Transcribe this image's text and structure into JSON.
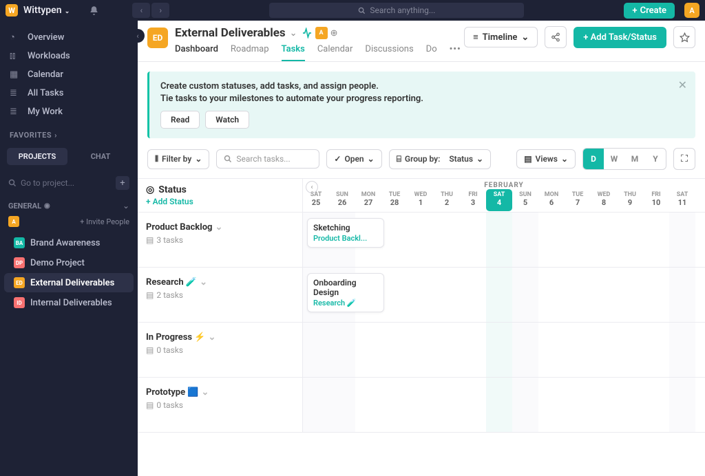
{
  "topbar": {
    "workspace": "Wittypen",
    "search_placeholder": "Search anything...",
    "create_label": "Create",
    "avatar_initial": "A"
  },
  "sidebar": {
    "nav": [
      {
        "label": "Overview",
        "icon": "dashboard-icon"
      },
      {
        "label": "Workloads",
        "icon": "chart-icon"
      },
      {
        "label": "Calendar",
        "icon": "calendar-icon"
      },
      {
        "label": "All Tasks",
        "icon": "list-icon"
      },
      {
        "label": "My Work",
        "icon": "list-icon"
      }
    ],
    "favorites_label": "FAVORITES",
    "tabs": {
      "projects": "PROJECTS",
      "chat": "CHAT"
    },
    "goto_placeholder": "Go to project...",
    "general_label": "GENERAL",
    "invite_label": "+ Invite People",
    "invite_badge": "A",
    "projects": [
      {
        "label": "Brand Awareness",
        "initials": "BA",
        "color": "#14b8a6"
      },
      {
        "label": "Demo Project",
        "initials": "DP",
        "color": "#f87171"
      },
      {
        "label": "External Deliverables",
        "initials": "ED",
        "color": "#f5a623",
        "active": true
      },
      {
        "label": "Internal Deliverables",
        "initials": "ID",
        "color": "#f87171"
      }
    ]
  },
  "header": {
    "badge": "ED",
    "title": "External Deliverables",
    "subtabs": [
      "Dashboard",
      "Roadmap",
      "Tasks",
      "Calendar",
      "Discussions",
      "Do"
    ],
    "active_tab": "Tasks",
    "timeline_label": "Timeline",
    "add_task_label": "+ Add Task/Status"
  },
  "banner": {
    "line1": "Create custom statuses, add tasks, and assign people.",
    "line2": "Tie tasks to your milestones to automate your progress reporting.",
    "read": "Read",
    "watch": "Watch"
  },
  "toolbar": {
    "filter": "Filter by",
    "search_placeholder": "Search tasks...",
    "open": "Open",
    "group_label": "Group by:",
    "group_value": "Status",
    "views": "Views",
    "zoom": [
      "D",
      "W",
      "M",
      "Y"
    ]
  },
  "timeline": {
    "status_title": "Status",
    "add_status": "+ Add Status",
    "month": "FEBRUARY",
    "days": [
      {
        "dow": "SAT",
        "num": "25"
      },
      {
        "dow": "SUN",
        "num": "26"
      },
      {
        "dow": "MON",
        "num": "27"
      },
      {
        "dow": "TUE",
        "num": "28"
      },
      {
        "dow": "WED",
        "num": "1"
      },
      {
        "dow": "THU",
        "num": "2"
      },
      {
        "dow": "FRI",
        "num": "3"
      },
      {
        "dow": "SAT",
        "num": "4",
        "current": true
      },
      {
        "dow": "SUN",
        "num": "5"
      },
      {
        "dow": "MON",
        "num": "6"
      },
      {
        "dow": "TUE",
        "num": "7"
      },
      {
        "dow": "WED",
        "num": "8"
      },
      {
        "dow": "THU",
        "num": "9"
      },
      {
        "dow": "FRI",
        "num": "10"
      },
      {
        "dow": "SAT",
        "num": "11"
      }
    ],
    "rows": [
      {
        "title": "Product Backlog",
        "count": "3 tasks",
        "card": {
          "title": "Sketching",
          "sub": "Product Backl..."
        }
      },
      {
        "title": "Research",
        "emoji": "🧪",
        "count": "2 tasks",
        "card": {
          "title": "Onboarding Design",
          "sub": "Research 🧪"
        }
      },
      {
        "title": "In Progress",
        "emoji": "⚡",
        "count": "0 tasks"
      },
      {
        "title": "Prototype",
        "emoji": "🟦",
        "count": "0 tasks"
      }
    ]
  }
}
